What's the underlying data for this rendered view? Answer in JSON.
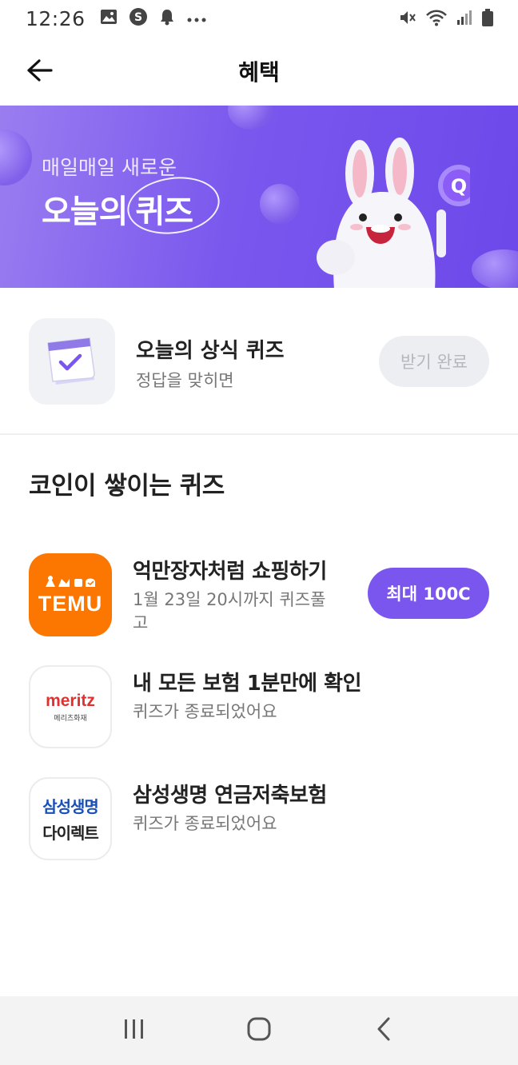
{
  "status_bar": {
    "time": "12:26",
    "left_icons": [
      "gallery-icon",
      "s-app-icon",
      "bell-icon",
      "more-dots-icon"
    ],
    "right_icons": [
      "mute-icon",
      "wifi-icon",
      "signal-icon",
      "battery-icon"
    ]
  },
  "header": {
    "title": "혜택",
    "back_icon": "arrow-left-icon"
  },
  "banner": {
    "subtitle": "매일매일 새로운",
    "title_prefix": "오늘의",
    "title_highlight": "퀴즈",
    "background_color": "#7a58ee"
  },
  "daily_quiz": {
    "title": "오늘의 상식 퀴즈",
    "subtitle": "정답을 맞히면",
    "button_label": "받기 완료",
    "icon": "calendar-check-icon"
  },
  "section": {
    "title": "코인이 쌓이는 퀴즈"
  },
  "quizzes": [
    {
      "logo_text": "TEMU",
      "title": "억만장자처럼 쇼핑하기",
      "subtitle_line1": "1월 23일 20시까지 퀴즈풀",
      "subtitle_line2": "고",
      "button_label": "최대 100C",
      "brand_color": "#fb7701"
    },
    {
      "logo_text_en": "meritz",
      "logo_text_ko": "메리츠화재",
      "title": "내 모든 보험 1분만에 확인",
      "subtitle": "퀴즈가 종료되었어요",
      "brand_color": "#e3302f"
    },
    {
      "logo_line1": "삼성생명",
      "logo_line2": "다이렉트",
      "title": "삼성생명 연금저축보험",
      "subtitle": "퀴즈가 종료되었어요",
      "brand_color": "#1a4fb8"
    }
  ],
  "nav_bar": {
    "buttons": [
      "recent-apps-icon",
      "home-icon",
      "back-nav-icon"
    ]
  },
  "colors": {
    "accent": "#7b56ee",
    "disabled_bg": "#eceef1",
    "disabled_text": "#b4b7bd"
  }
}
